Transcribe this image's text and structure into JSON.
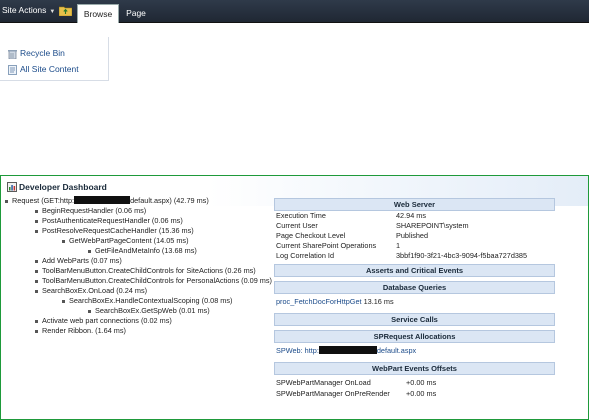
{
  "ribbon": {
    "site_actions": "Site Actions",
    "tabs": [
      {
        "label": "Browse",
        "active": true
      },
      {
        "label": "Page",
        "active": false
      }
    ]
  },
  "quick_launch": {
    "items": [
      "Recycle Bin",
      "All Site Content"
    ]
  },
  "dashboard": {
    "title": "Developer Dashboard",
    "tree": [
      {
        "text_pre": "Request (GET:http:",
        "text_post": "default.aspx) (42.79 ms)",
        "redacted": true
      },
      {
        "text": "BeginRequestHandler (0.06 ms)"
      },
      {
        "text": "PostAuthenticateRequestHandler (0.06 ms)"
      },
      {
        "text": "PostResolveRequestCacheHandler (15.36 ms)"
      },
      {
        "text": "GetWebPartPageContent (14.05 ms)"
      },
      {
        "text": "GetFileAndMetaInfo (13.68 ms)"
      },
      {
        "text": "Add WebParts (0.07 ms)"
      },
      {
        "text": "ToolBarMenuButton.CreateChildControls for SiteActions (0.26 ms)"
      },
      {
        "text": "ToolBarMenuButton.CreateChildControls for PersonalActions (0.09 ms)"
      },
      {
        "text": "SearchBoxEx.OnLoad (0.24 ms)"
      },
      {
        "text": "SearchBoxEx.HandleContextualScoping (0.08 ms)"
      },
      {
        "text": "SearchBoxEx.GetSpWeb (0.01 ms)"
      },
      {
        "text": "Activate web part connections (0.02 ms)"
      },
      {
        "text": "Render Ribbon. (1.64 ms)"
      }
    ],
    "web_server": {
      "header": "Web Server",
      "rows": [
        {
          "key": "Execution Time",
          "value": "42.94 ms"
        },
        {
          "key": "Current User",
          "value": "SHAREPOINT\\system"
        },
        {
          "key": "Page Checkout Level",
          "value": "Published"
        },
        {
          "key": "Current SharePoint Operations",
          "value": "1"
        },
        {
          "key": "Log Correlation Id",
          "value": "3bbf1f90-3f21-4bc3-9094-f5baa727d385"
        }
      ]
    },
    "asserts": {
      "header": "Asserts and Critical Events"
    },
    "database": {
      "header": "Database Queries",
      "query_link": "proc_FetchDocForHttpGet",
      "query_time": "13.16 ms"
    },
    "service_calls": {
      "header": "Service Calls"
    },
    "spreq": {
      "header": "SPRequest Allocations",
      "link_pre": "SPWeb: http:",
      "link_post": "default.aspx"
    },
    "webpart": {
      "header": "WebPart Events Offsets",
      "rows": [
        {
          "key": "SPWebPartManager OnLoad",
          "value": "+0.00 ms"
        },
        {
          "key": "SPWebPartManager OnPreRender",
          "value": "+0.00 ms"
        }
      ]
    }
  }
}
